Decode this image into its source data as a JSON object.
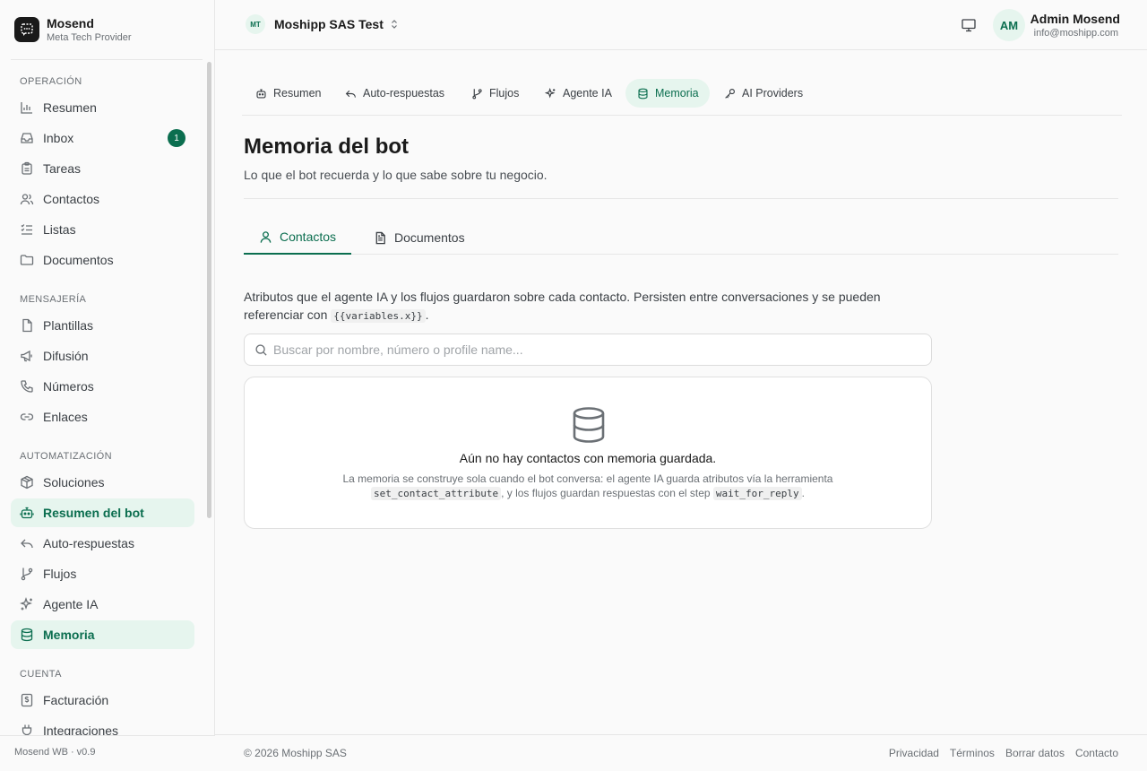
{
  "brand": {
    "name": "Mosend",
    "subtitle": "Meta Tech Provider"
  },
  "sidebar": {
    "sections": [
      {
        "title": "OPERACIÓN",
        "items": [
          {
            "label": "Resumen",
            "icon": "bar-chart-icon"
          },
          {
            "label": "Inbox",
            "icon": "inbox-icon",
            "badge": "1"
          },
          {
            "label": "Tareas",
            "icon": "clipboard-icon"
          },
          {
            "label": "Contactos",
            "icon": "users-icon"
          },
          {
            "label": "Listas",
            "icon": "list-icon"
          },
          {
            "label": "Documentos",
            "icon": "folder-icon"
          }
        ]
      },
      {
        "title": "MENSAJERÍA",
        "items": [
          {
            "label": "Plantillas",
            "icon": "file-icon"
          },
          {
            "label": "Difusión",
            "icon": "megaphone-icon"
          },
          {
            "label": "Números",
            "icon": "phone-icon"
          },
          {
            "label": "Enlaces",
            "icon": "link-icon"
          }
        ]
      },
      {
        "title": "AUTOMATIZACIÓN",
        "items": [
          {
            "label": "Soluciones",
            "icon": "package-icon"
          },
          {
            "label": "Resumen del bot",
            "icon": "bot-icon",
            "active": true
          },
          {
            "label": "Auto-respuestas",
            "icon": "reply-icon"
          },
          {
            "label": "Flujos",
            "icon": "git-branch-icon"
          },
          {
            "label": "Agente IA",
            "icon": "sparkles-icon"
          },
          {
            "label": "Memoria",
            "icon": "database-icon",
            "active": true
          }
        ]
      },
      {
        "title": "CUENTA",
        "items": [
          {
            "label": "Facturación",
            "icon": "receipt-icon"
          },
          {
            "label": "Integraciones",
            "icon": "plug-icon"
          }
        ]
      }
    ],
    "footer": "Mosend WB · v0.9"
  },
  "header": {
    "workspace_initials": "MT",
    "workspace_name": "Moshipp SAS Test",
    "user_initials": "AM",
    "user_name": "Admin Mosend",
    "user_email": "info@moshipp.com"
  },
  "top_tabs": [
    {
      "label": "Resumen",
      "icon": "bot-icon"
    },
    {
      "label": "Auto-respuestas",
      "icon": "reply-icon"
    },
    {
      "label": "Flujos",
      "icon": "git-branch-icon"
    },
    {
      "label": "Agente IA",
      "icon": "sparkles-icon"
    },
    {
      "label": "Memoria",
      "icon": "database-icon",
      "active": true
    },
    {
      "label": "AI Providers",
      "icon": "key-icon"
    }
  ],
  "page": {
    "title": "Memoria del bot",
    "subtitle": "Lo que el bot recuerda y lo que sabe sobre tu negocio."
  },
  "sub_tabs": [
    {
      "label": "Contactos",
      "icon": "user-icon",
      "active": true
    },
    {
      "label": "Documentos",
      "icon": "file-text-icon"
    }
  ],
  "description": {
    "text": "Atributos que el agente IA y los flujos guardaron sobre cada contacto. Persisten entre conversaciones y se pueden referenciar con",
    "code": "{{variables.x}}",
    "end": "."
  },
  "search": {
    "placeholder": "Buscar por nombre, número o profile name...",
    "value": ""
  },
  "empty_state": {
    "title": "Aún no hay contactos con memoria guardada.",
    "desc_1": "La memoria se construye sola cuando el bot conversa: el agente IA guarda atributos vía la herramienta",
    "code_1": "set_contact_attribute",
    "desc_2": ", y los flujos guardan respuestas con el step",
    "code_2": "wait_for_reply",
    "desc_3": "."
  },
  "footer": {
    "copyright": "© 2026 Moshipp SAS",
    "links": [
      "Privacidad",
      "Términos",
      "Borrar datos",
      "Contacto"
    ]
  },
  "colors": {
    "accent": "#0b6e4f",
    "accent_bg": "#e6f5ee",
    "text": "#1a1a1a",
    "muted": "#6b7075",
    "border": "#e6e6e6"
  }
}
